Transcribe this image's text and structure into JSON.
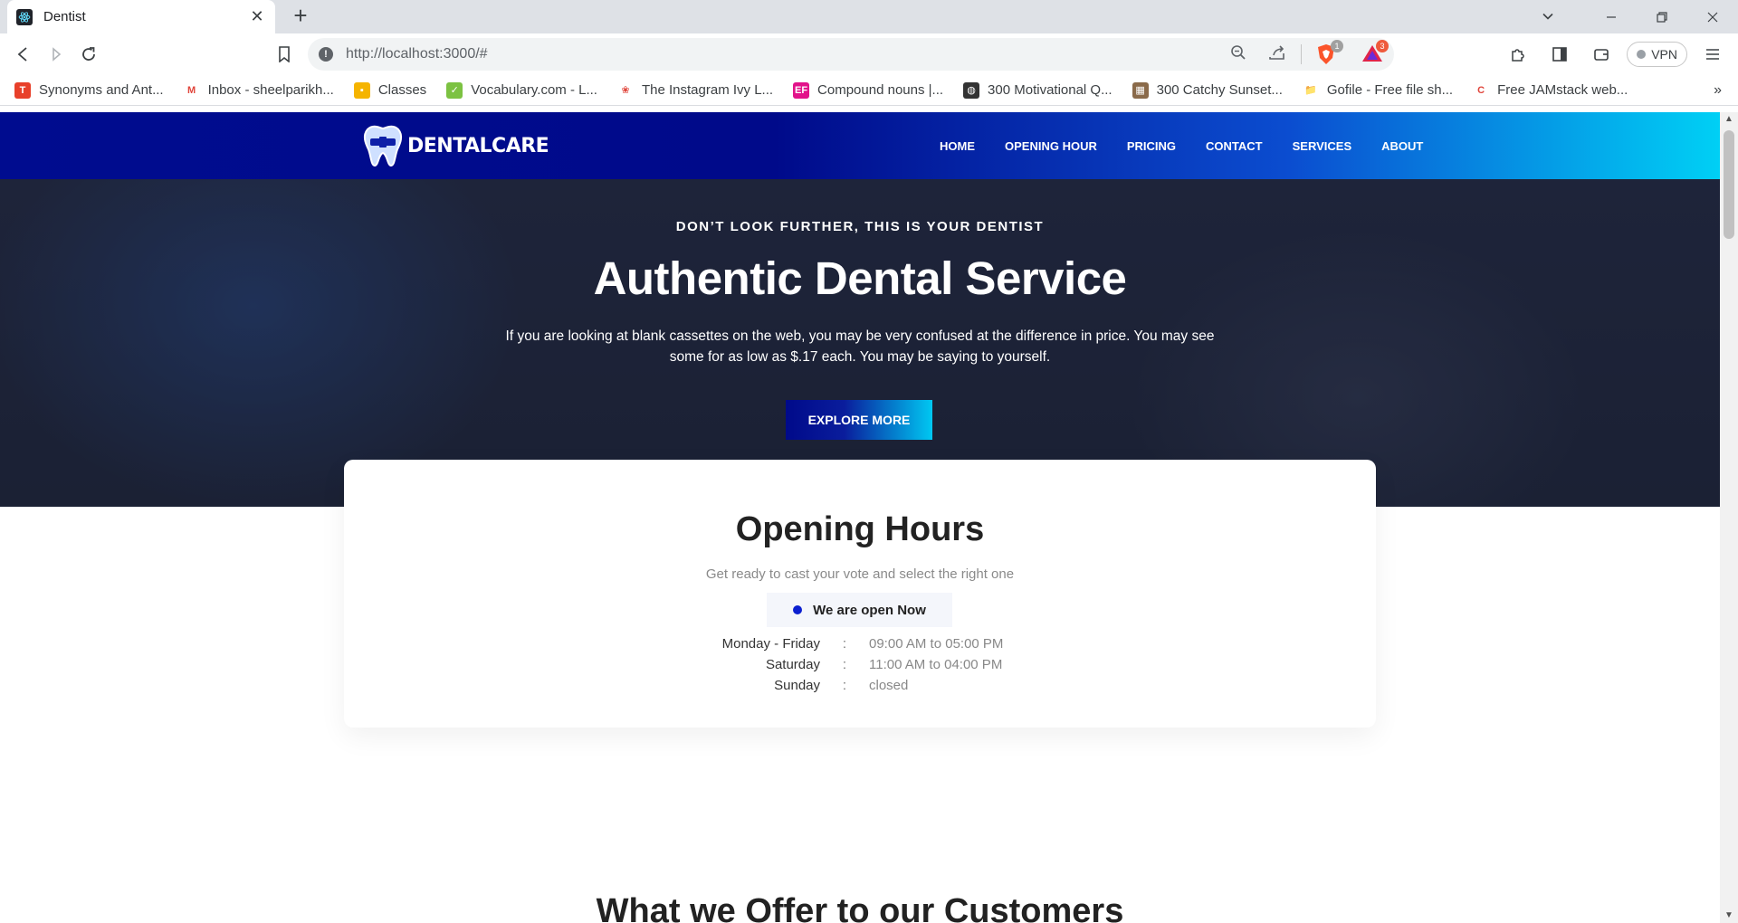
{
  "browser": {
    "tab_title": "Dentist",
    "url": "http://localhost:3000/#",
    "vpn_label": "VPN",
    "shield_badge": "1",
    "rewards_badge": "3",
    "bookmarks": [
      {
        "label": "Synonyms and Ant...",
        "icon": "thesaurus-icon",
        "color": "#e8402a",
        "glyph": "T"
      },
      {
        "label": "Inbox - sheelparikh...",
        "icon": "gmail-icon",
        "color": "#ffffff",
        "glyph": "M"
      },
      {
        "label": "Classes",
        "icon": "classroom-icon",
        "color": "#f5b400",
        "glyph": "▪"
      },
      {
        "label": "Vocabulary.com - L...",
        "icon": "vocabulary-icon",
        "color": "#7cc242",
        "glyph": "✓"
      },
      {
        "label": "The Instagram Ivy L...",
        "icon": "ivy-icon",
        "color": "#ffffff",
        "glyph": "❀"
      },
      {
        "label": "Compound nouns |...",
        "icon": "ef-icon",
        "color": "#e2138a",
        "glyph": "EF"
      },
      {
        "label": "300 Motivational Q...",
        "icon": "globe-icon",
        "color": "#333333",
        "glyph": "◍"
      },
      {
        "label": "300 Catchy Sunset...",
        "icon": "photo-icon",
        "color": "#8a6a4a",
        "glyph": "▦"
      },
      {
        "label": "Gofile - Free file sh...",
        "icon": "gofile-icon",
        "color": "#ffffff",
        "glyph": "📁"
      },
      {
        "label": "Free JAMstack web...",
        "icon": "jamstack-icon",
        "color": "#ffffff",
        "glyph": "C"
      }
    ],
    "bookmarks_more": "»"
  },
  "site": {
    "logo_text": "DENTALCARE",
    "nav": [
      "HOME",
      "OPENING HOUR",
      "PRICING",
      "CONTACT",
      "SERVICES",
      "ABOUT"
    ],
    "hero": {
      "kicker": "DON’T LOOK FURTHER, THIS IS YOUR DENTIST",
      "headline": "Authentic Dental Service",
      "lead": "If you are looking at blank cassettes on the web, you may be very confused at the difference in price. You may see some for as low as $.17 each. You may be saying to yourself.",
      "cta": "EXPLORE MORE"
    },
    "hours": {
      "title": "Opening Hours",
      "subtitle": "Get ready to cast your vote and select the right one",
      "status": "We are open Now",
      "separator": ":",
      "rows": [
        {
          "day": "Monday - Friday",
          "time": "09:00 AM to 05:00 PM"
        },
        {
          "day": "Saturday",
          "time": "11:00 AM to 04:00 PM"
        },
        {
          "day": "Sunday",
          "time": "closed"
        }
      ]
    },
    "offer_title": "What we Offer to our Customers"
  }
}
